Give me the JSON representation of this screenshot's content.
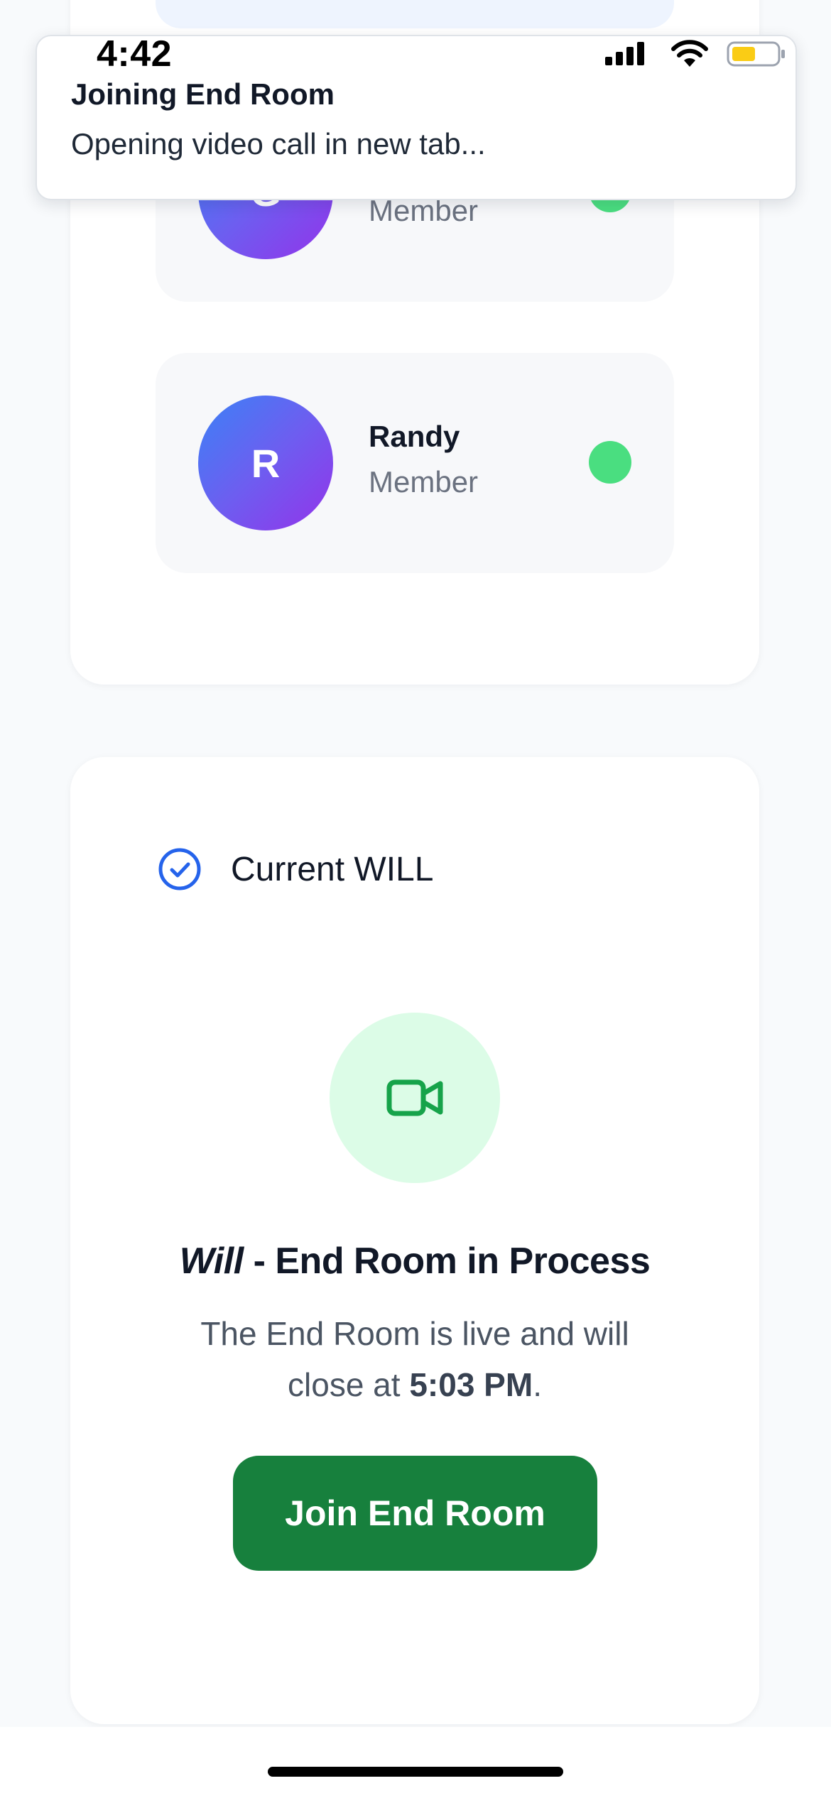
{
  "status_bar": {
    "time": "4:42",
    "signal_icon": "signal-bars-icon",
    "wifi_icon": "wifi-icon",
    "battery_icon": "battery-low-icon",
    "battery_color": "#facc15"
  },
  "toast": {
    "title": "Joining End Room",
    "message": "Opening video call in new tab..."
  },
  "members": [
    {
      "initial": "G",
      "name": "",
      "role": "Member",
      "status": "online"
    },
    {
      "initial": "R",
      "name": "Randy",
      "role": "Member",
      "status": "online"
    }
  ],
  "will_card": {
    "header_icon": "check-circle-icon",
    "title": "Current WILL",
    "status_icon": "video-camera-icon",
    "heading_em": "Will",
    "heading_rest": " - End Room in Process",
    "desc_before": "The End Room is live and will close at ",
    "close_time": "5:03 PM",
    "desc_after": ".",
    "join_button_label": "Join End Room"
  },
  "colors": {
    "accent_blue": "#2563eb",
    "join_button": "#17803d",
    "online_dot": "#4ade80",
    "video_circle_bg": "#dcfce7",
    "video_icon": "#16a34a"
  }
}
